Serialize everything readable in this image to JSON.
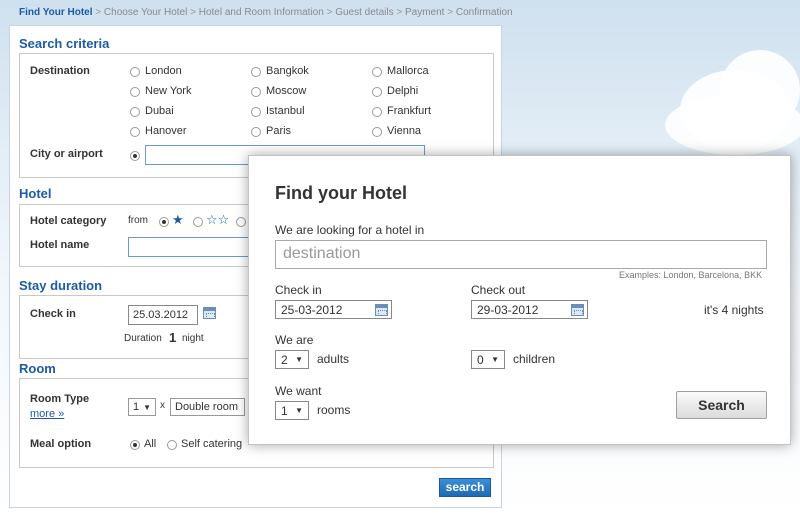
{
  "breadcrumb": {
    "active": "Find Your Hotel",
    "steps": [
      "Choose Your Hotel",
      "Hotel and Room Information",
      "Guest details",
      "Payment",
      "Confirmation"
    ],
    "separator": ">"
  },
  "search_criteria": {
    "title": "Search criteria",
    "destination_label": "Destination",
    "destinations": [
      "London",
      "Bangkok",
      "Mallorca",
      "New York",
      "Moscow",
      "Delphi",
      "Dubai",
      "Istanbul",
      "Frankfurt",
      "Hanover",
      "Paris",
      "Vienna"
    ],
    "city_label": "City or airport",
    "city_value": ""
  },
  "hotel": {
    "title": "Hotel",
    "category_label": "Hotel category",
    "category_from": "from",
    "name_label": "Hotel name",
    "name_value": ""
  },
  "stay": {
    "title": "Stay duration",
    "checkin_label": "Check in",
    "checkin_value": "25.03.2012",
    "duration_label": "Duration",
    "duration_value": "1",
    "duration_unit": "night"
  },
  "room": {
    "title": "Room",
    "type_label": "Room Type",
    "more_link": "more »",
    "qty": "1",
    "times": "x",
    "type_value": "Double room",
    "meal_label": "Meal option",
    "meal_options": [
      "All",
      "Self catering"
    ]
  },
  "search_button": "search",
  "dialog": {
    "title": "Find your Hotel",
    "looking_label": "We are looking for a hotel in",
    "destination_placeholder": "destination",
    "examples": "Examples: London, Barcelona, BKK",
    "checkin_label": "Check in",
    "checkin_value": "25-03-2012",
    "checkout_label": "Check out",
    "checkout_value": "29-03-2012",
    "nights_text": "it's 4 nights",
    "we_are_label": "We are",
    "adults_value": "2",
    "adults_label": "adults",
    "children_value": "0",
    "children_label": "children",
    "we_want_label": "We want",
    "rooms_value": "1",
    "rooms_label": "rooms",
    "search_button": "Search"
  },
  "colors": {
    "accent": "#1d5ba6",
    "button_blue": "#2a7cc7"
  },
  "icons": {
    "calendar": "calendar-icon",
    "star": "star-icon",
    "dropdown": "chevron-down-icon"
  }
}
